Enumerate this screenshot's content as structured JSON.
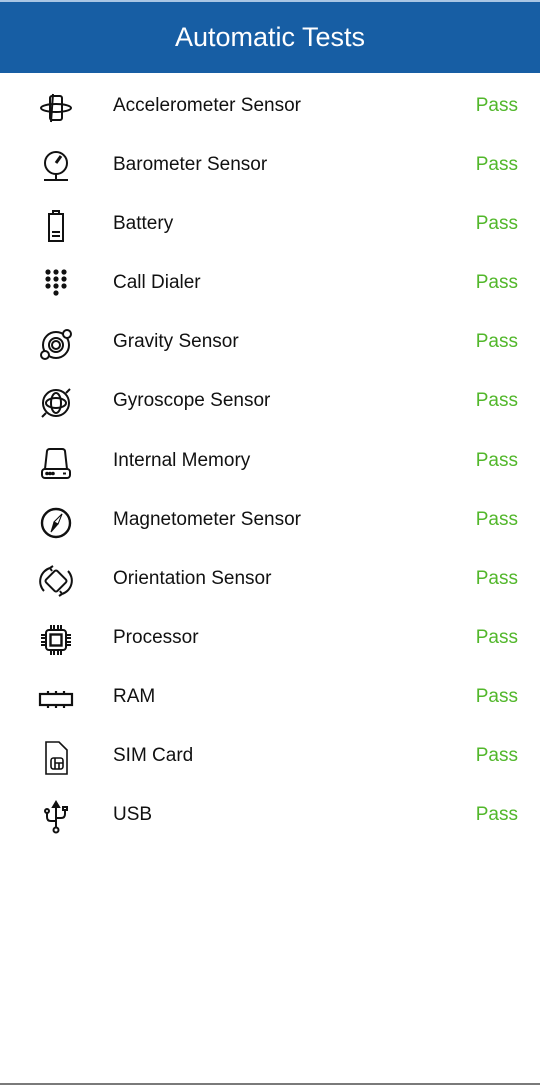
{
  "header": {
    "title": "Automatic Tests"
  },
  "colors": {
    "header_bg": "#175ea4",
    "pass": "#52b72b"
  },
  "tests": [
    {
      "name": "Accelerometer Sensor",
      "icon": "accelerometer-icon",
      "status": "Pass"
    },
    {
      "name": "Barometer Sensor",
      "icon": "barometer-icon",
      "status": "Pass"
    },
    {
      "name": "Battery",
      "icon": "battery-icon",
      "status": "Pass"
    },
    {
      "name": "Call Dialer",
      "icon": "dialpad-icon",
      "status": "Pass"
    },
    {
      "name": "Gravity Sensor",
      "icon": "gravity-icon",
      "status": "Pass"
    },
    {
      "name": "Gyroscope Sensor",
      "icon": "gyroscope-icon",
      "status": "Pass"
    },
    {
      "name": "Internal Memory",
      "icon": "storage-drive-icon",
      "status": "Pass"
    },
    {
      "name": "Magnetometer Sensor",
      "icon": "compass-icon",
      "status": "Pass"
    },
    {
      "name": "Orientation Sensor",
      "icon": "screen-rotation-icon",
      "status": "Pass"
    },
    {
      "name": "Processor",
      "icon": "cpu-chip-icon",
      "status": "Pass"
    },
    {
      "name": "RAM",
      "icon": "ram-module-icon",
      "status": "Pass"
    },
    {
      "name": "SIM Card",
      "icon": "sim-card-icon",
      "status": "Pass"
    },
    {
      "name": "USB",
      "icon": "usb-icon",
      "status": "Pass"
    }
  ]
}
